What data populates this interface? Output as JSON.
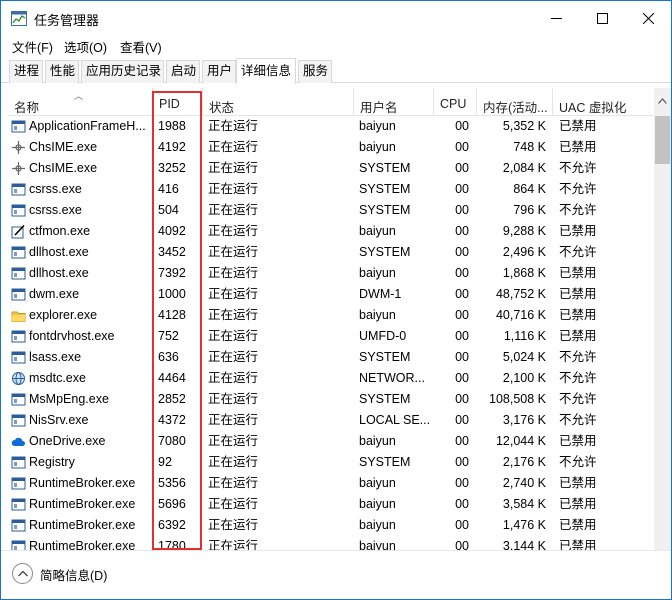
{
  "window": {
    "title": "任务管理器"
  },
  "menu": {
    "file": "文件(F)",
    "options": "选项(O)",
    "view": "查看(V)"
  },
  "tabs": [
    "进程",
    "性能",
    "应用历史记录",
    "启动",
    "用户",
    "详细信息",
    "服务"
  ],
  "columns": {
    "name": "名称",
    "pid": "PID",
    "status": "状态",
    "user": "用户名",
    "cpu": "CPU",
    "mem": "内存(活动...",
    "uac": "UAC 虚拟化"
  },
  "rows": [
    {
      "icon": "app-window-icon",
      "name": "ApplicationFrameH...",
      "pid": "1988",
      "status": "正在运行",
      "user": "baiyun",
      "cpu": "00",
      "mem": "5,352 K",
      "uac": "已禁用"
    },
    {
      "icon": "ime-icon",
      "name": "ChsIME.exe",
      "pid": "4192",
      "status": "正在运行",
      "user": "baiyun",
      "cpu": "00",
      "mem": "748 K",
      "uac": "已禁用"
    },
    {
      "icon": "ime-icon",
      "name": "ChsIME.exe",
      "pid": "3252",
      "status": "正在运行",
      "user": "SYSTEM",
      "cpu": "00",
      "mem": "2,084 K",
      "uac": "不允许"
    },
    {
      "icon": "app-window-icon",
      "name": "csrss.exe",
      "pid": "416",
      "status": "正在运行",
      "user": "SYSTEM",
      "cpu": "00",
      "mem": "864 K",
      "uac": "不允许"
    },
    {
      "icon": "app-window-icon",
      "name": "csrss.exe",
      "pid": "504",
      "status": "正在运行",
      "user": "SYSTEM",
      "cpu": "00",
      "mem": "796 K",
      "uac": "不允许"
    },
    {
      "icon": "pen-icon",
      "name": "ctfmon.exe",
      "pid": "4092",
      "status": "正在运行",
      "user": "baiyun",
      "cpu": "00",
      "mem": "9,288 K",
      "uac": "已禁用"
    },
    {
      "icon": "app-window-icon",
      "name": "dllhost.exe",
      "pid": "3452",
      "status": "正在运行",
      "user": "SYSTEM",
      "cpu": "00",
      "mem": "2,496 K",
      "uac": "不允许"
    },
    {
      "icon": "app-window-icon",
      "name": "dllhost.exe",
      "pid": "7392",
      "status": "正在运行",
      "user": "baiyun",
      "cpu": "00",
      "mem": "1,868 K",
      "uac": "已禁用"
    },
    {
      "icon": "app-window-icon",
      "name": "dwm.exe",
      "pid": "1000",
      "status": "正在运行",
      "user": "DWM-1",
      "cpu": "00",
      "mem": "48,752 K",
      "uac": "已禁用"
    },
    {
      "icon": "folder-icon",
      "name": "explorer.exe",
      "pid": "4128",
      "status": "正在运行",
      "user": "baiyun",
      "cpu": "00",
      "mem": "40,716 K",
      "uac": "已禁用"
    },
    {
      "icon": "app-window-icon",
      "name": "fontdrvhost.exe",
      "pid": "752",
      "status": "正在运行",
      "user": "UMFD-0",
      "cpu": "00",
      "mem": "1,116 K",
      "uac": "已禁用"
    },
    {
      "icon": "app-window-icon",
      "name": "lsass.exe",
      "pid": "636",
      "status": "正在运行",
      "user": "SYSTEM",
      "cpu": "00",
      "mem": "5,024 K",
      "uac": "不允许"
    },
    {
      "icon": "network-icon",
      "name": "msdtc.exe",
      "pid": "4464",
      "status": "正在运行",
      "user": "NETWOR...",
      "cpu": "00",
      "mem": "2,100 K",
      "uac": "不允许"
    },
    {
      "icon": "app-window-icon",
      "name": "MsMpEng.exe",
      "pid": "2852",
      "status": "正在运行",
      "user": "SYSTEM",
      "cpu": "00",
      "mem": "108,508 K",
      "uac": "不允许"
    },
    {
      "icon": "app-window-icon",
      "name": "NisSrv.exe",
      "pid": "4372",
      "status": "正在运行",
      "user": "LOCAL SE...",
      "cpu": "00",
      "mem": "3,176 K",
      "uac": "不允许"
    },
    {
      "icon": "cloud-icon",
      "name": "OneDrive.exe",
      "pid": "7080",
      "status": "正在运行",
      "user": "baiyun",
      "cpu": "00",
      "mem": "12,044 K",
      "uac": "已禁用"
    },
    {
      "icon": "app-window-icon",
      "name": "Registry",
      "pid": "92",
      "status": "正在运行",
      "user": "SYSTEM",
      "cpu": "00",
      "mem": "2,176 K",
      "uac": "不允许"
    },
    {
      "icon": "app-window-icon",
      "name": "RuntimeBroker.exe",
      "pid": "5356",
      "status": "正在运行",
      "user": "baiyun",
      "cpu": "00",
      "mem": "2,740 K",
      "uac": "已禁用"
    },
    {
      "icon": "app-window-icon",
      "name": "RuntimeBroker.exe",
      "pid": "5696",
      "status": "正在运行",
      "user": "baiyun",
      "cpu": "00",
      "mem": "3,584 K",
      "uac": "已禁用"
    },
    {
      "icon": "app-window-icon",
      "name": "RuntimeBroker.exe",
      "pid": "6392",
      "status": "正在运行",
      "user": "baiyun",
      "cpu": "00",
      "mem": "1,476 K",
      "uac": "已禁用"
    },
    {
      "icon": "app-window-icon",
      "name": "RuntimeBroker.exe",
      "pid": "1780",
      "status": "正在运行",
      "user": "baiyun",
      "cpu": "00",
      "mem": "3,144 K",
      "uac": "已禁用"
    }
  ],
  "footer": {
    "fewer_details": "简略信息(D)"
  },
  "colors": {
    "highlight": "#e03030",
    "border": "#1a73c9"
  }
}
